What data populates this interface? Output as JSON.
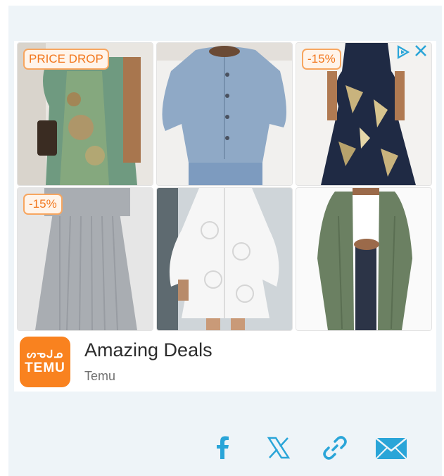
{
  "ad": {
    "tiles": [
      {
        "badge": "PRICE DROP",
        "product": "green floral midi dress"
      },
      {
        "badge": "",
        "product": "blue button-back sweater"
      },
      {
        "badge": "-15%",
        "product": "navy floral maxi dress"
      },
      {
        "badge": "-15%",
        "product": "grey pleated maxi dress"
      },
      {
        "badge": "",
        "product": "white lace tiered dress"
      },
      {
        "badge": "",
        "product": "green cable-knit cardigan"
      }
    ],
    "brand_logo_glyphs": "ᔕᓀᒍᓄ",
    "brand_logo_text": "TEMU",
    "title": "Amazing Deals",
    "advertiser": "Temu",
    "adchoices_icon": "adchoices-triangle-icon",
    "close_icon": "close-x-icon"
  },
  "share": {
    "items": [
      {
        "icon": "facebook-icon"
      },
      {
        "icon": "x-twitter-icon"
      },
      {
        "icon": "link-icon"
      },
      {
        "icon": "email-icon"
      }
    ],
    "color": "#2aa5d8"
  },
  "colors": {
    "panel_bg": "#eef4f8",
    "badge_text": "#f2771d",
    "brand_orange": "#f9821f"
  }
}
